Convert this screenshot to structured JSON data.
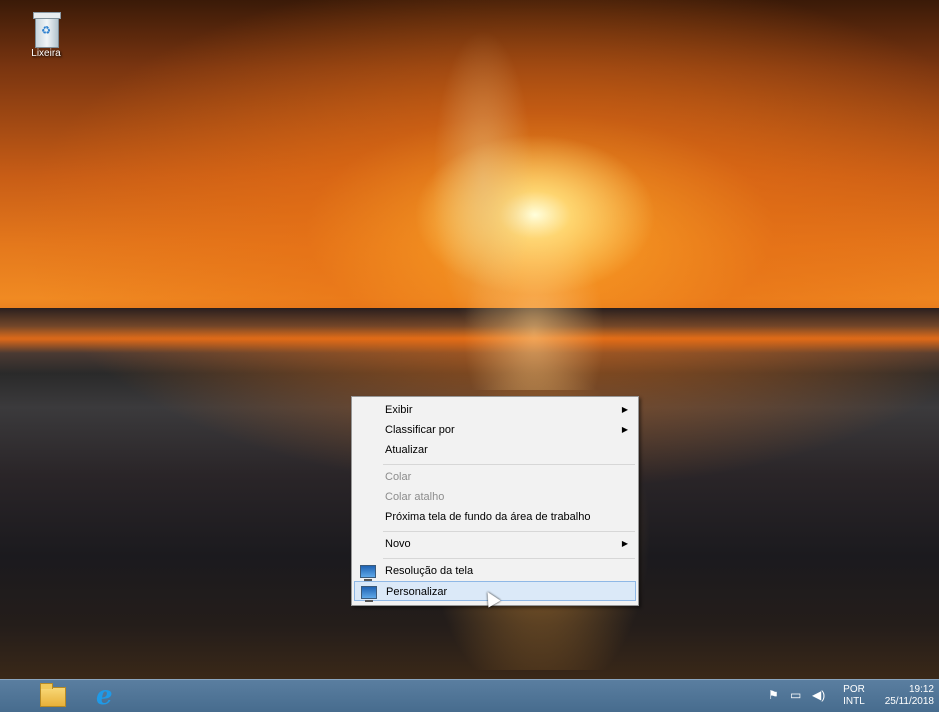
{
  "desktop": {
    "icons": [
      {
        "label": "Lixeira",
        "icon": "recycle-bin-icon"
      }
    ]
  },
  "context_menu": {
    "items": [
      {
        "label": "Exibir",
        "submenu": true,
        "enabled": true
      },
      {
        "label": "Classificar por",
        "submenu": true,
        "enabled": true
      },
      {
        "label": "Atualizar",
        "submenu": false,
        "enabled": true
      },
      {
        "label": "Colar",
        "submenu": false,
        "enabled": false
      },
      {
        "label": "Colar atalho",
        "submenu": false,
        "enabled": false
      },
      {
        "label": "Próxima tela de fundo da área de trabalho",
        "submenu": false,
        "enabled": true
      },
      {
        "label": "Novo",
        "submenu": true,
        "enabled": true
      },
      {
        "label": "Resolução da tela",
        "submenu": false,
        "enabled": true,
        "icon": "display-icon"
      },
      {
        "label": "Personalizar",
        "submenu": false,
        "enabled": true,
        "icon": "personalize-icon",
        "highlighted": true
      }
    ],
    "submenu_arrow": "▶"
  },
  "taskbar": {
    "pinned": [
      {
        "name": "file-explorer",
        "icon": "folder-icon"
      },
      {
        "name": "internet-explorer",
        "icon": "ie-icon",
        "glyph": "e"
      }
    ],
    "tray": {
      "icons": [
        "action-center-icon",
        "network-icon",
        "volume-icon"
      ],
      "language": {
        "line1": "POR",
        "line2": "INTL"
      },
      "clock": {
        "time": "19:12",
        "date": "25/11/2018"
      }
    }
  }
}
